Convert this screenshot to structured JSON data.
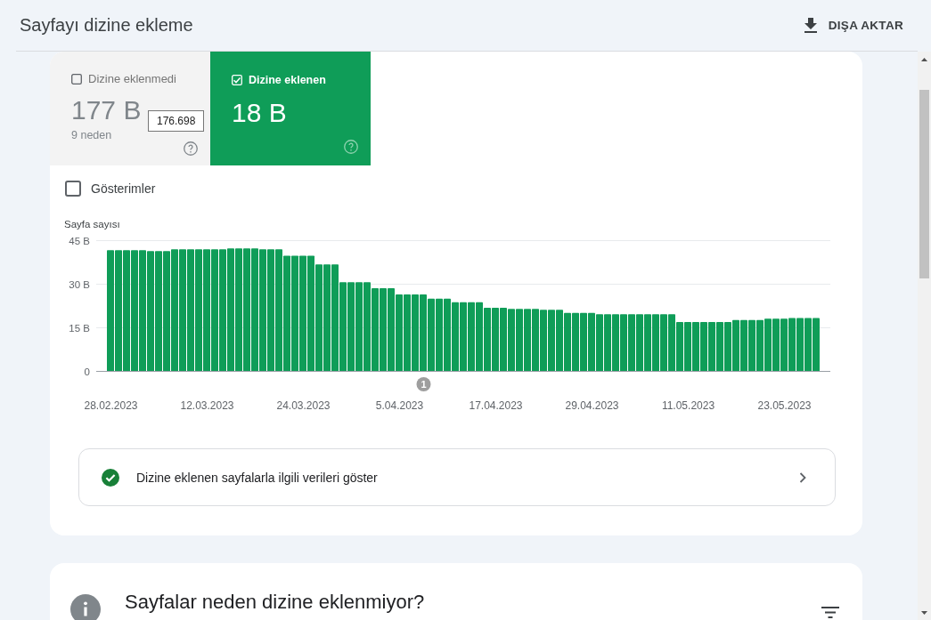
{
  "header": {
    "title": "Sayfayı dizine ekleme",
    "export_button": "DIŞA AKTAR"
  },
  "report_card": {
    "tiles": [
      {
        "label": "Dizine eklenmedi",
        "checked": false,
        "selected": false,
        "value": "177 B",
        "detail": "9 neden",
        "tooltip": "176.698"
      },
      {
        "label": "Dizine eklenen",
        "checked": true,
        "selected": true,
        "value": "18 B"
      }
    ],
    "impressions": {
      "label": "Gösterimler",
      "checked": false
    },
    "chart": {
      "chart_data": {
        "type": "bar",
        "ylabel": "Sayfa sayısı",
        "ylim": [
          0,
          45
        ],
        "yticks": [
          {
            "value": 0,
            "label": "0"
          },
          {
            "value": 15,
            "label": "15 B"
          },
          {
            "value": 30,
            "label": "30 B"
          },
          {
            "value": 45,
            "label": "45 B"
          }
        ],
        "categories": [
          "28.02.2023",
          null,
          null,
          null,
          null,
          null,
          null,
          null,
          null,
          null,
          null,
          null,
          "12.03.2023",
          null,
          null,
          null,
          null,
          null,
          null,
          null,
          null,
          null,
          null,
          null,
          "24.03.2023",
          null,
          null,
          null,
          null,
          null,
          null,
          null,
          null,
          null,
          null,
          null,
          "5.04.2023",
          null,
          null,
          null,
          null,
          null,
          null,
          null,
          null,
          null,
          null,
          null,
          "17.04.2023",
          null,
          null,
          null,
          null,
          null,
          null,
          null,
          null,
          null,
          null,
          null,
          "29.04.2023",
          null,
          null,
          null,
          null,
          null,
          null,
          null,
          null,
          null,
          null,
          null,
          "11.05.2023",
          null,
          null,
          null,
          null,
          null,
          null,
          null,
          null,
          null,
          null,
          null,
          "23.05.2023",
          null,
          null,
          null,
          null
        ],
        "series": [
          {
            "color": "#0f9d58",
            "values": [
              41.7,
              41.7,
              41.7,
              41.7,
              41.7,
              41.4,
              41.4,
              41.4,
              42.0,
              42.0,
              42.0,
              42.0,
              42.0,
              42.0,
              42.0,
              42.3,
              42.3,
              42.3,
              42.3,
              42.0,
              42.0,
              42.0,
              39.8,
              39.8,
              39.8,
              39.8,
              36.8,
              36.8,
              36.8,
              30.7,
              30.7,
              30.7,
              30.7,
              28.6,
              28.6,
              28.6,
              26.5,
              26.5,
              26.5,
              26.5,
              25.0,
              25.0,
              25.0,
              23.8,
              23.8,
              23.8,
              23.8,
              21.9,
              21.9,
              21.9,
              21.5,
              21.5,
              21.5,
              21.5,
              21.2,
              21.2,
              21.2,
              20.1,
              20.1,
              20.1,
              20.1,
              19.7,
              19.7,
              19.7,
              19.7,
              19.7,
              19.7,
              19.7,
              19.7,
              19.7,
              19.7,
              17.0,
              17.0,
              17.0,
              17.0,
              17.0,
              17.0,
              17.0,
              17.7,
              17.7,
              17.7,
              17.7,
              18.1,
              18.1,
              18.1,
              18.4,
              18.4,
              18.4,
              18.4
            ]
          }
        ],
        "annotations": [
          "1"
        ]
      }
    },
    "details_link": "Dizine eklenen sayfalarla ilgili verileri göster"
  },
  "reasons_card": {
    "title": "Sayfalar neden dizine eklenmiyor?"
  }
}
